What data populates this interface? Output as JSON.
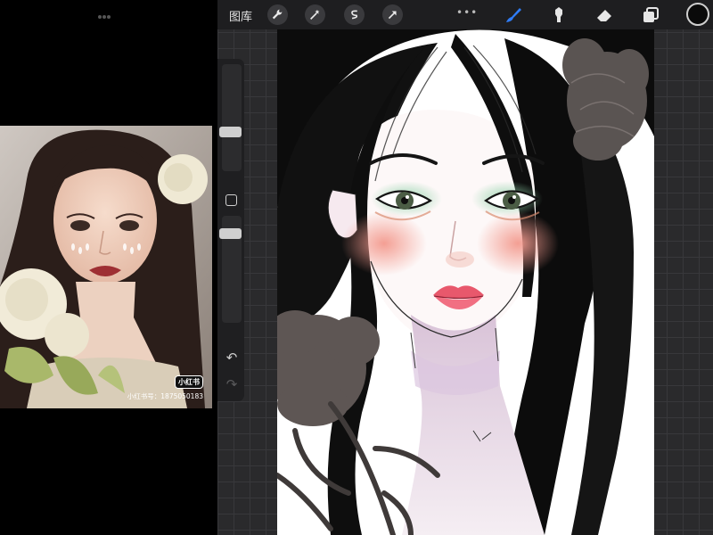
{
  "reference_image": {
    "watermark_logo": "小红书",
    "watermark_id": "小红书号：1875050183"
  },
  "toolbar": {
    "gallery_label": "图库",
    "tools": [
      "wrench-icon",
      "magic-wand-icon",
      "selection-s-icon",
      "transform-arrow-icon"
    ],
    "paint_tools": [
      "brush-icon",
      "smudge-icon",
      "eraser-icon",
      "layers-icon"
    ],
    "more_label": "•••",
    "active_color": "#0a0a0a",
    "active_tool_color": "#2f7cf6"
  },
  "sidebar": {
    "undo_label": "↶",
    "redo_label": "↷"
  }
}
